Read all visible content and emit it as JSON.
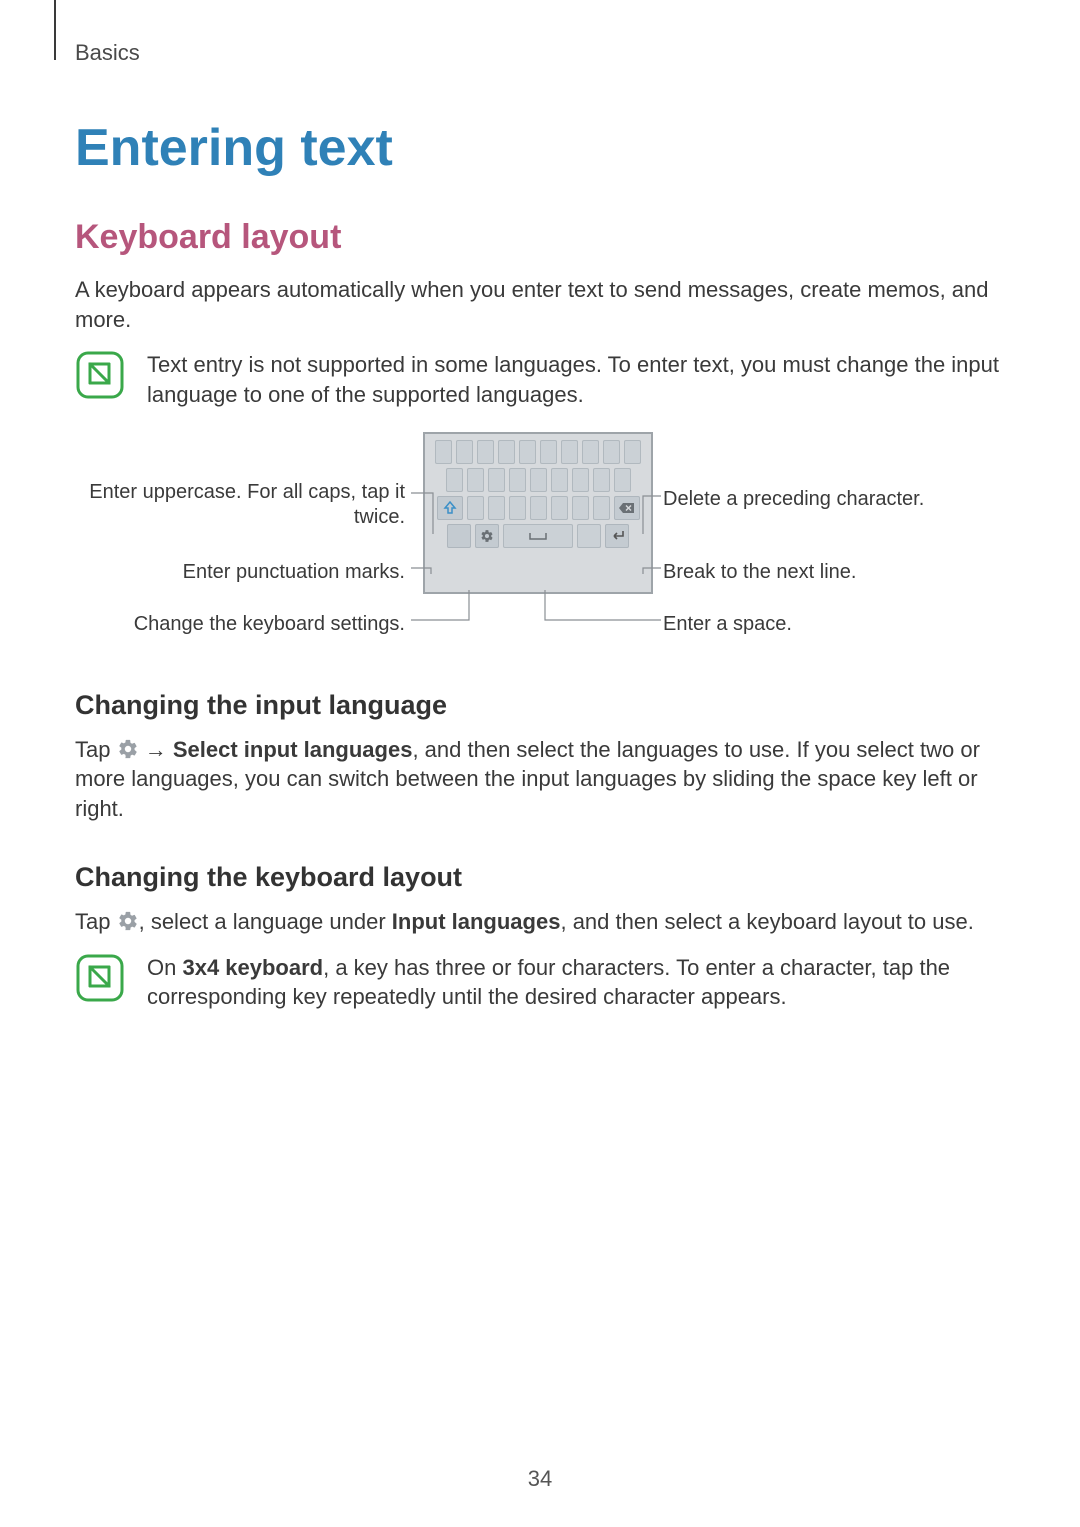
{
  "crumb": "Basics",
  "title": "Entering text",
  "h2": "Keyboard layout",
  "intro": "A keyboard appears automatically when you enter text to send messages, create memos, and more.",
  "note1": "Text entry is not supported in some languages. To enter text, you must change the input language to one of the supported languages.",
  "diagram": {
    "upper_left": "Enter uppercase. For all caps, tap it twice.",
    "upper_right": "Delete a preceding character.",
    "mid_left": "Enter punctuation marks.",
    "mid_right": "Break to the next line.",
    "lower_left": "Change the keyboard settings.",
    "lower_right": "Enter a space."
  },
  "h3a": "Changing the input language",
  "p3a_pre": "Tap ",
  "p3a_arrow": " → ",
  "p3a_bold": "Select input languages",
  "p3a_post": ", and then select the languages to use. If you select two or more languages, you can switch between the input languages by sliding the space key left or right.",
  "h3b": "Changing the keyboard layout",
  "p3b_pre": "Tap ",
  "p3b_mid": ", select a language under ",
  "p3b_bold": "Input languages",
  "p3b_post": ", and then select a keyboard layout to use.",
  "note2_pre": "On ",
  "note2_bold": "3x4 keyboard",
  "note2_post": ", a key has three or four characters. To enter a character, tap the corresponding key repeatedly until the desired character appears.",
  "pagenum": "34"
}
